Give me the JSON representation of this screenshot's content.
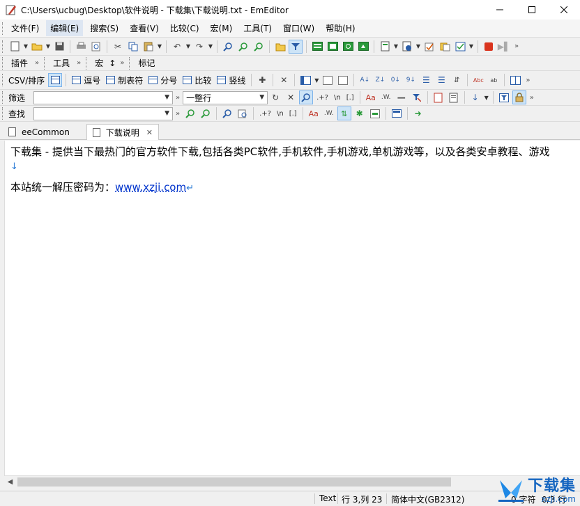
{
  "window": {
    "title": "C:\\Users\\ucbug\\Desktop\\软件说明 - 下载集\\下载说明.txt - EmEditor"
  },
  "menubar": {
    "items": [
      "文件(F)",
      "编辑(E)",
      "搜索(S)",
      "查看(V)",
      "比较(C)",
      "宏(M)",
      "工具(T)",
      "窗口(W)",
      "帮助(H)"
    ],
    "active": "编辑(E)"
  },
  "plugins_bar": {
    "plugins": "插件",
    "tools": "工具",
    "macro": "宏",
    "macro_suffix": "↕",
    "marks": "标记"
  },
  "csv_bar": {
    "label": "CSV/排序",
    "items": [
      "逗号",
      "制表符",
      "分号",
      "比较",
      "竖线"
    ]
  },
  "filter_bar": {
    "label": "筛选",
    "value": "",
    "mode": "一整行",
    "regex": ".+?",
    "newline": "\\n",
    "brackets": "[.]"
  },
  "find_bar": {
    "label": "查找",
    "value": "",
    "regex": ".+?",
    "newline": "\\n",
    "brackets": "[.]"
  },
  "tabs": [
    {
      "label": "eeCommon",
      "active": false
    },
    {
      "label": "下载说明",
      "active": true
    }
  ],
  "editor": {
    "line1": "下载集 - 提供当下最热门的官方软件下载,包括各类PC软件,手机软件,手机游戏,单机游戏等，以及各类安卓教程、游戏",
    "line2_prefix": "本站统一解压密码为：",
    "line2_link": "www.xzji.com",
    "wrap_mark": "↓",
    "return_mark": "↵"
  },
  "status": {
    "mode": "Text",
    "position": "行 3,列 23",
    "encoding": "简体中文(GB2312)",
    "chars": "0 字符",
    "lines": "0/3 行"
  },
  "watermark": {
    "big": "下载集",
    "small": "xzji.com"
  },
  "colors": {
    "accent": "#1565c0",
    "link": "#0033cc",
    "selected": "#cde4f7"
  }
}
